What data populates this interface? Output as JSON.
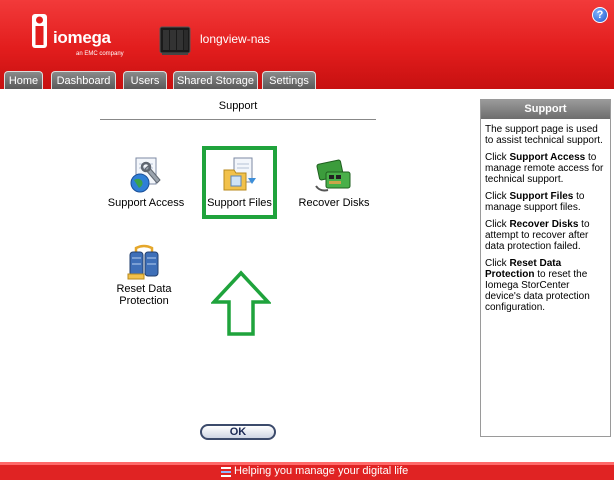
{
  "header": {
    "brand": "iomega",
    "brand_sub": "an EMC company",
    "device_name": "longview-nas",
    "help_label": "?"
  },
  "tabs": [
    {
      "label": "Home"
    },
    {
      "label": "Dashboard"
    },
    {
      "label": "Users"
    },
    {
      "label": "Shared Storage"
    },
    {
      "label": "Settings"
    }
  ],
  "main": {
    "title": "Support",
    "tiles": [
      {
        "label": "Support Access",
        "icon": "support-access-icon"
      },
      {
        "label": "Support Files",
        "icon": "support-files-icon"
      },
      {
        "label": "Recover Disks",
        "icon": "recover-disks-icon"
      },
      {
        "label_line1": "Reset Data",
        "label_line2": "Protection",
        "icon": "reset-data-protection-icon"
      }
    ],
    "ok_label": "OK"
  },
  "side_panel": {
    "title": "Support",
    "intro": "The support page is used to assist technical support.",
    "items": [
      {
        "prefix": "Click ",
        "term": "Support Access",
        "text": " to manage remote access for technical support."
      },
      {
        "prefix": "Click ",
        "term": "Support Files",
        "text": " to manage support files."
      },
      {
        "prefix": "Click ",
        "term": "Recover Disks",
        "text": " to attempt to recover after data protection failed."
      },
      {
        "prefix": "Click ",
        "term": "Reset Data Protection",
        "text": " to reset the Iomega StorCenter device's data protection configuration."
      }
    ]
  },
  "footer": {
    "tagline": "Helping you manage your digital life"
  },
  "colors": {
    "brand_red": "#e21d1d",
    "highlight_green": "#1fa33c",
    "tab_gray": "#6d6d6d"
  }
}
